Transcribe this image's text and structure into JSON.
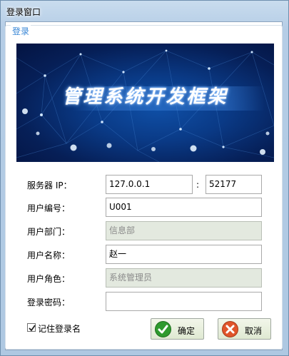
{
  "window": {
    "title": "登录窗口"
  },
  "group": {
    "title": "登录"
  },
  "banner": {
    "title": "管理系统开发框架"
  },
  "form": {
    "server_ip": {
      "label": "服务器 IP：",
      "value": "127.0.0.1"
    },
    "port_separator": ":",
    "port": {
      "value": "52177"
    },
    "user_code": {
      "label": "用户编号：",
      "value": "U001"
    },
    "department": {
      "label": "用户部门：",
      "value": "信息部"
    },
    "user_name": {
      "label": "用户名称：",
      "value": "赵一"
    },
    "role": {
      "label": "用户角色：",
      "value": "系统管理员"
    },
    "password": {
      "label": "登录密码：",
      "value": ""
    }
  },
  "remember": {
    "label": "记住登录名",
    "checked": true
  },
  "buttons": {
    "ok": "确定",
    "cancel": "取消"
  },
  "colors": {
    "accent": "#3a87d6",
    "ok_icon": "#2e9a2e",
    "cancel_icon": "#e0552b"
  }
}
